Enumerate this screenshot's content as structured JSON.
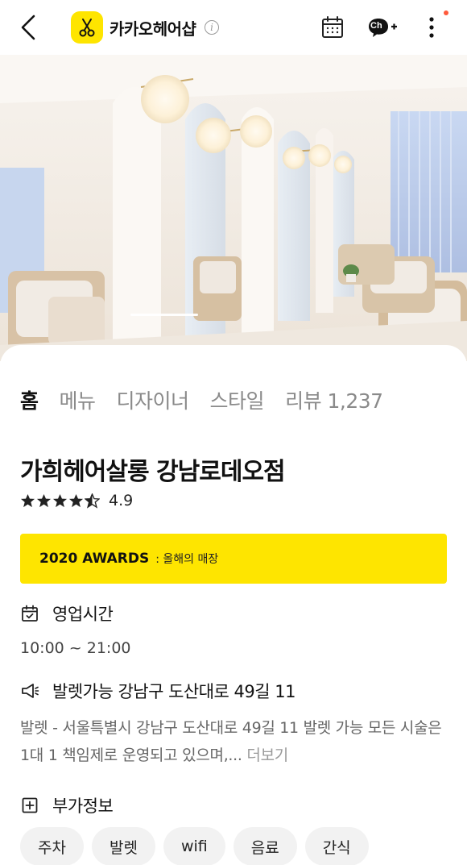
{
  "header": {
    "brand_name": "카카오헤어샵",
    "info_glyph": "i",
    "icons": {
      "back": "chevron-left-icon",
      "logo": "scissors-icon",
      "calendar": "calendar-icon",
      "channel": "channel-plus-icon",
      "more": "more-vertical-icon"
    },
    "channel_label": "Ch",
    "notification_color": "#ff5a3c"
  },
  "hero": {
    "description": "salon interior photo",
    "slide_position": "current"
  },
  "tabs": [
    {
      "label": "홈",
      "active": true
    },
    {
      "label": "메뉴",
      "active": false
    },
    {
      "label": "디자이너",
      "active": false
    },
    {
      "label": "스타일",
      "active": false
    },
    {
      "label": "리뷰 1,237",
      "active": false
    }
  ],
  "shop": {
    "name": "가희헤어살롱 강남로데오점",
    "rating": 4.9,
    "rating_text": "4.9",
    "stars_filled": 4.5
  },
  "award": {
    "title": "2020 AWARDS",
    "subtitle": ": 올해의 매장"
  },
  "hours": {
    "label": "영업시간",
    "value": "10:00 ~ 21:00"
  },
  "notice": {
    "label": "발렛가능 강남구 도산대로 49길 11",
    "text": "발렛 - 서울특별시 강남구 도산대로 49길 11 발렛 가능 모든 시술은 1대 1 책임제로 운영되고 있으며,...",
    "more_label": "더보기"
  },
  "extra": {
    "label": "부가정보",
    "chips": [
      "주차",
      "발렛",
      "wifi",
      "음료",
      "간식"
    ]
  },
  "colors": {
    "accent": "#FEE500",
    "text_primary": "#111111",
    "text_secondary": "#8a8a8a"
  }
}
